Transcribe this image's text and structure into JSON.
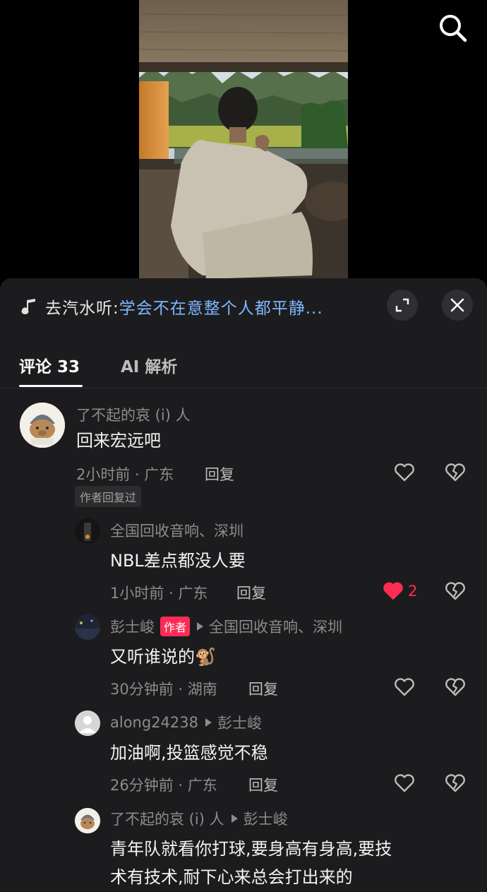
{
  "music": {
    "artist_label": "去汽水听:",
    "song_label": "学会不在意整个人都平静..."
  },
  "tabs": [
    {
      "label": "评论 33"
    },
    {
      "label": "AI 解析"
    }
  ],
  "comments": [
    {
      "user": "了不起的哀 (i) 人",
      "text": "回来宏远吧",
      "meta": "2小时前 · 广东",
      "reply": "回复",
      "tag": "作者回复过"
    },
    {
      "user": "全国回收音响、深圳",
      "text": "NBL差点都没人要",
      "meta": "1小时前 · 广东",
      "reply": "回复",
      "likes": "2"
    },
    {
      "user": "彭士峻",
      "badge": "作者",
      "reply_to": "全国回收音响、深圳",
      "text": "又听谁说的🐒",
      "meta": "30分钟前 · 湖南",
      "reply": "回复"
    },
    {
      "user": "along24238",
      "reply_to": "彭士峻",
      "text": "加油啊,投篮感觉不稳",
      "meta": "26分钟前 · 广东",
      "reply": "回复"
    },
    {
      "user": "了不起的哀 (i) 人",
      "reply_to": "彭士峻",
      "text_line1": "青年队就看你打球,要身高有身高,要技",
      "text_line2": "术有技术,耐下心来总会打出来的"
    }
  ],
  "colors": {
    "sheet_bg": "#1c1c1e",
    "accent_red": "#fe2c55",
    "song_blue": "#7fb7ff",
    "muted_text": "#8c8c8c"
  },
  "icons": [
    "search-icon",
    "music-note-icon",
    "expand-icon",
    "close-icon",
    "heart-icon",
    "broken-heart-icon"
  ]
}
